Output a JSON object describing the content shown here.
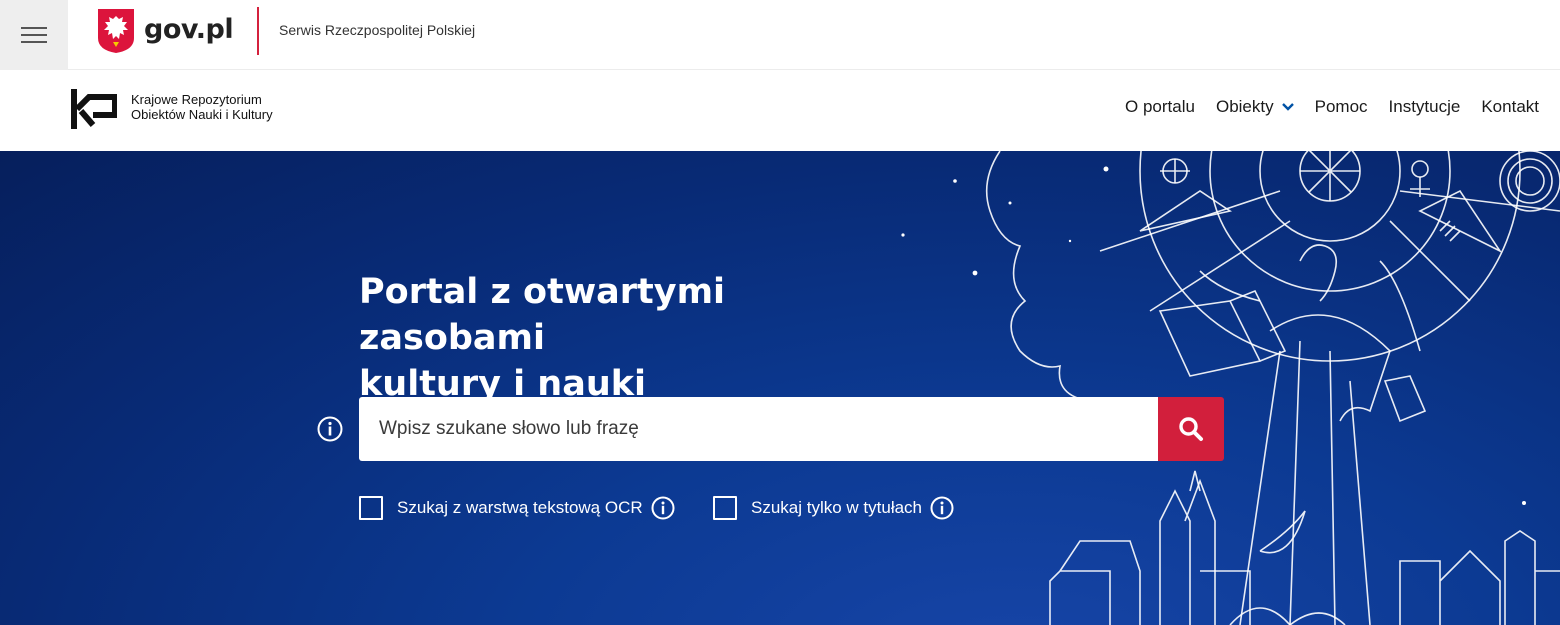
{
  "govbar": {
    "brand": "gov.pl",
    "serwis": "Serwis Rzeczpospolitej Polskiej",
    "menu_icon": "hamburger-menu-icon",
    "emblem_icon": "polish-eagle-emblem"
  },
  "header": {
    "logo_icon": "kronik-logo-icon",
    "logo_line1": "Krajowe Repozytorium",
    "logo_line2": "Obiektów Nauki i Kultury",
    "nav": [
      {
        "label": "O portalu"
      },
      {
        "label": "Obiekty",
        "has_dropdown": true
      },
      {
        "label": "Pomoc"
      },
      {
        "label": "Instytucje"
      },
      {
        "label": "Kontakt"
      }
    ]
  },
  "hero": {
    "title_line1": "Portal z otwartymi zasobami",
    "title_line2": "kultury i nauki",
    "search_placeholder": "Wpisz szukane słowo lub frazę",
    "search_icon": "search-icon",
    "options": [
      {
        "label": "Szukaj z warstwą tekstową OCR",
        "checked": false
      },
      {
        "label": "Szukaj tylko w tytułach",
        "checked": false
      }
    ]
  },
  "colors": {
    "accent_red": "#d21f3c",
    "hero_blue": "#0a3284",
    "nav_chevron": "#0052a5"
  }
}
